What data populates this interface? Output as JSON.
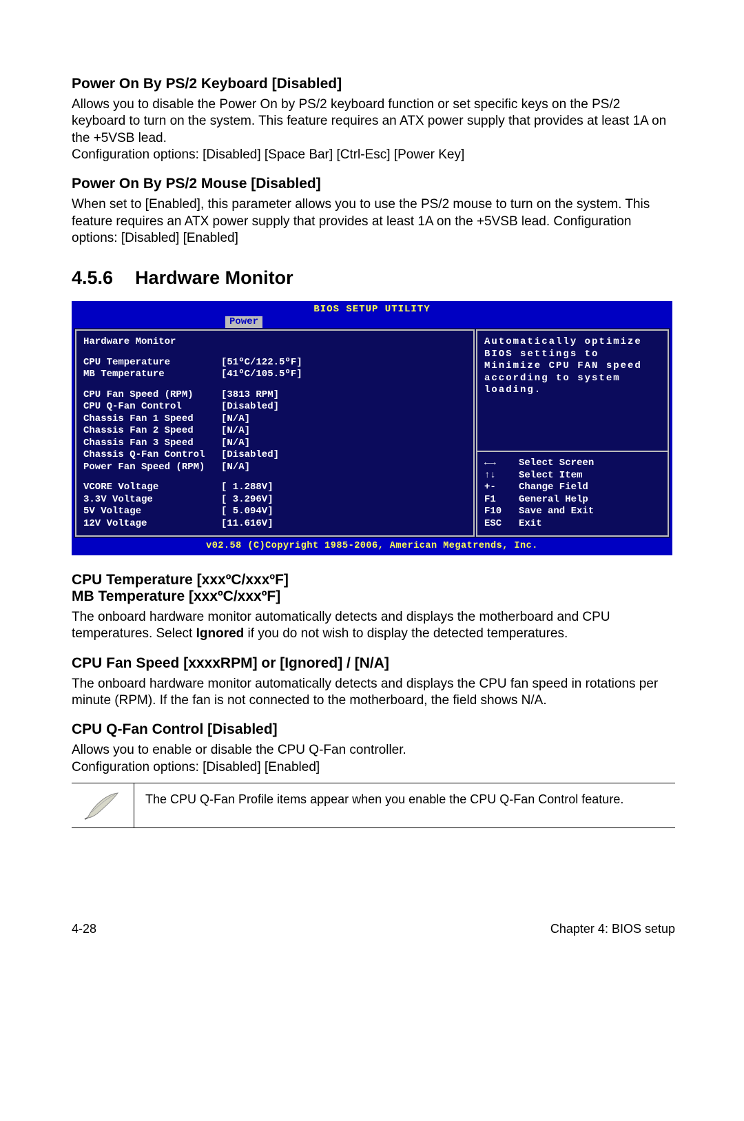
{
  "sections": {
    "ps2kb": {
      "title": "Power On By PS/2 Keyboard [Disabled]",
      "body1": "Allows you to disable the Power On by PS/2 keyboard function or set specific keys on the PS/2 keyboard to turn on the system. This feature requires an ATX power supply that provides at least 1A on the +5VSB lead.",
      "body2": "Configuration options: [Disabled] [Space Bar] [Ctrl-Esc] [Power Key]"
    },
    "ps2mouse": {
      "title": "Power On By PS/2 Mouse [Disabled]",
      "body": "When set to [Enabled], this parameter allows you to use the PS/2 mouse to turn on the system. This feature requires an ATX power supply that provides at least 1A on the +5VSB lead. Configuration options: [Disabled] [Enabled]"
    },
    "hwmon": {
      "num": "4.5.6",
      "title": "Hardware Monitor"
    },
    "cputemp": {
      "title1": "CPU Temperature [xxxºC/xxxºF]",
      "title2": "MB Temperature [xxxºC/xxxºF]",
      "body": "The onboard hardware monitor automatically detects and displays the motherboard and CPU temperatures. Select Ignored if you do not wish to display the detected temperatures."
    },
    "cpufan": {
      "title": "CPU Fan Speed [xxxxRPM] or [Ignored] / [N/A]",
      "body": "The onboard hardware monitor automatically detects and displays the CPU fan speed in rotations per minute (RPM). If the fan is not connected to the motherboard, the field shows N/A."
    },
    "qfan": {
      "title": "CPU Q-Fan Control [Disabled]",
      "body1": "Allows you to enable or disable the CPU Q-Fan controller.",
      "body2": "Configuration options: [Disabled] [Enabled]"
    },
    "note": {
      "text": "The CPU Q-Fan Profile items appear when you enable the CPU Q-Fan Control feature."
    }
  },
  "bios": {
    "title": "BIOS SETUP UTILITY",
    "tab": "Power",
    "heading": "Hardware Monitor",
    "items": [
      {
        "label": "CPU Temperature",
        "value": "[51ºC/122.5ºF]"
      },
      {
        "label": "MB Temperature",
        "value": "[41ºC/105.5ºF]"
      },
      {
        "label": "",
        "value": ""
      },
      {
        "label": "CPU Fan Speed (RPM)",
        "value": "[3813 RPM]"
      },
      {
        "label": "CPU Q-Fan Control",
        "value": "[Disabled]"
      },
      {
        "label": "Chassis Fan 1 Speed",
        "value": "[N/A]"
      },
      {
        "label": "Chassis Fan 2 Speed",
        "value": "[N/A]"
      },
      {
        "label": "Chassis Fan 3 Speed",
        "value": "[N/A]"
      },
      {
        "label": "Chassis Q-Fan Control",
        "value": "[Disabled]"
      },
      {
        "label": "Power Fan Speed (RPM)",
        "value": "[N/A]"
      },
      {
        "label": "",
        "value": ""
      },
      {
        "label": "VCORE Voltage",
        "value": "[ 1.288V]"
      },
      {
        "label": "3.3V Voltage",
        "value": "[ 3.296V]"
      },
      {
        "label": "5V Voltage",
        "value": "[ 5.094V]"
      },
      {
        "label": "12V Voltage",
        "value": "[11.616V]"
      }
    ],
    "side_help": "Automatically optimize BIOS settings to Minimize CPU FAN speed according to system loading.",
    "nav": [
      {
        "k": "←→",
        "t": "Select Screen"
      },
      {
        "k": "↑↓",
        "t": "Select Item"
      },
      {
        "k": "+-",
        "t": "Change Field"
      },
      {
        "k": "F1",
        "t": "General Help"
      },
      {
        "k": "F10",
        "t": "Save and Exit"
      },
      {
        "k": "ESC",
        "t": "Exit"
      }
    ],
    "footer": "v02.58 (C)Copyright 1985-2006, American Megatrends, Inc."
  },
  "footer": {
    "left": "4-28",
    "right": "Chapter 4: BIOS setup"
  }
}
